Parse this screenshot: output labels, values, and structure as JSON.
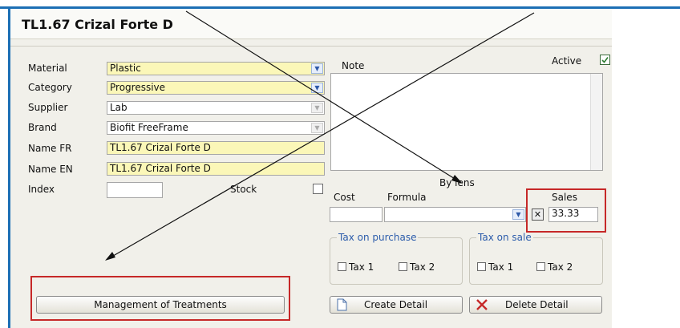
{
  "window": {
    "title": "TL1.67 Crizal Forte D"
  },
  "form": {
    "material_label": "Material",
    "material_value": "Plastic",
    "category_label": "Category",
    "category_value": "Progressive",
    "supplier_label": "Supplier",
    "supplier_value": "Lab",
    "brand_label": "Brand",
    "brand_value": "Biofit FreeFrame",
    "name_fr_label": "Name FR",
    "name_fr_value": "TL1.67 Crizal Forte D",
    "name_en_label": "Name EN",
    "name_en_value": "TL1.67 Crizal Forte D",
    "index_label": "Index",
    "index_value": "",
    "stock_label": "Stock"
  },
  "note": {
    "label": "Note",
    "value": ""
  },
  "active": {
    "label": "Active",
    "checked": true
  },
  "by_lens": {
    "label": "By lens"
  },
  "pricing": {
    "cost_label": "Cost",
    "cost_value": "",
    "formula_label": "Formula",
    "formula_value": "",
    "sales_label": "Sales",
    "sales_value": "33.33"
  },
  "tax_purchase": {
    "title": "Tax on purchase",
    "tax1": "Tax 1",
    "tax2": "Tax 2"
  },
  "tax_sale": {
    "title": "Tax on sale",
    "tax1": "Tax 1",
    "tax2": "Tax 2"
  },
  "buttons": {
    "management": "Management of Treatments",
    "create_detail": "Create Detail",
    "delete_detail": "Delete Detail"
  },
  "icons": {
    "clear": "close-icon",
    "create": "document-icon",
    "delete": "delete-x-icon"
  },
  "colors": {
    "window_border": "#1c6fb5",
    "highlight": "#c62828",
    "required_field": "#fbf7b8",
    "group_title": "#2c5cab"
  }
}
